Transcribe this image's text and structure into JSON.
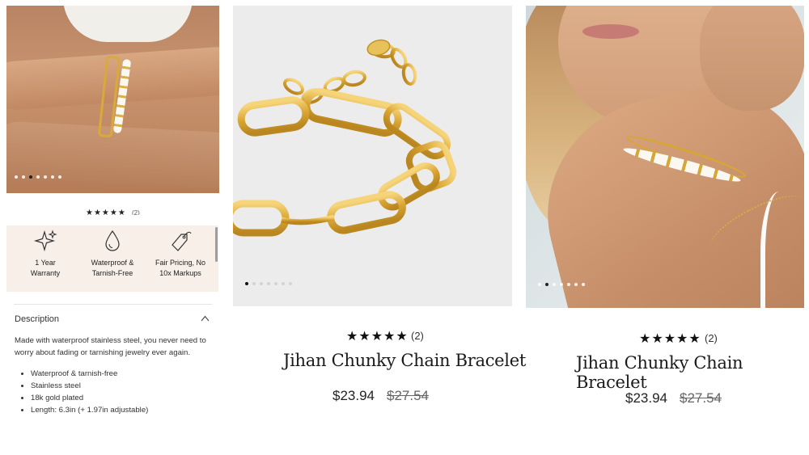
{
  "left_panel": {
    "rating_mini": {
      "stars": "★★★★★",
      "count": "(2)"
    },
    "features": [
      {
        "icon": "sparkle-icon",
        "label": "1 Year Warranty"
      },
      {
        "icon": "water-drop-icon",
        "label": "Waterproof & Tarnish-Free"
      },
      {
        "icon": "price-tag-icon",
        "label": "Fair Pricing, No 10x Markups"
      }
    ],
    "description": {
      "title": "Description",
      "text": "Made with waterproof stainless steel, you never need to worry about fading or tarnishing jewelry ever again.",
      "bullets": [
        "Waterproof & tarnish-free",
        "Stainless steel",
        "18k gold plated",
        "Length: 6.3in (+ 1.97in adjustable)"
      ]
    },
    "gallery": {
      "dot_count": 7,
      "active_dot": 2
    }
  },
  "products": [
    {
      "title": "Jihan Chunky Chain Bracelet",
      "stars": "★★★★★",
      "review_count": "(2)",
      "price": "$23.94",
      "compare_price": "$27.54",
      "gallery": {
        "dot_count": 7,
        "active_dot": 0
      }
    },
    {
      "title": "Jihan Chunky Chain Bracelet",
      "stars": "★★★★★",
      "review_count": "(2)",
      "price": "$23.94",
      "compare_price": "$27.54",
      "gallery": {
        "dot_count": 7,
        "active_dot": 1
      }
    }
  ],
  "colors": {
    "feature_bg": "#f7efe8",
    "gold": "#d6a636"
  }
}
